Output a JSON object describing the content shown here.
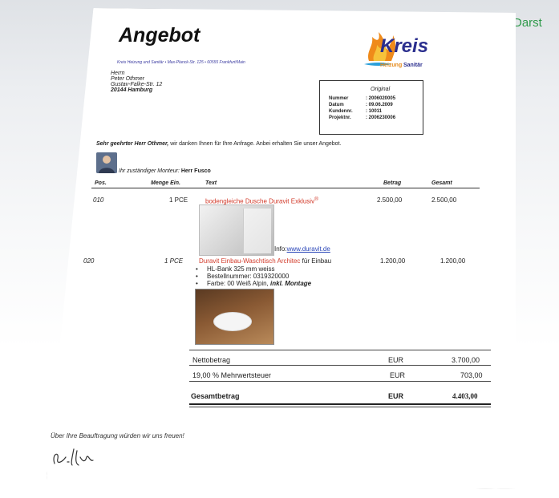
{
  "corner_label": "Darst",
  "document": {
    "title": "Angebot",
    "sender_line": "Kreis Heizung und Sanitär • Max-Planck-Str. 125 • 60555 Frankfurt/Main",
    "recipient": {
      "salutation": "Herrn",
      "name": "Peter Othmer",
      "street": "Gustav-Falke-Str. 12",
      "city": "20144 Hamburg"
    },
    "logo": {
      "name": "Kreis",
      "sub1": "Heizung",
      "sub2": "Sanitär"
    },
    "info_box": {
      "heading": "Original",
      "rows": [
        {
          "label": "Nummer",
          "value": ": 2006020005"
        },
        {
          "label": "Datum",
          "value": ": 09.06.2009"
        },
        {
          "label": "Kundennr.",
          "value": ": 10011"
        },
        {
          "label": "Projektnr.",
          "value": ": 2006230006"
        }
      ]
    },
    "greeting_name": "Sehr geehrter Herr Othmer,",
    "greeting_text": " wir danken Ihnen für Ihre Anfrage. Anbei erhalten Sie unser Angebot.",
    "monteur_text": "Ihr zuständiger Monteur: ",
    "monteur_name": "Herr Fusco",
    "table_headers": {
      "pos": "Pos.",
      "qty": "Menge Ein.",
      "text": "Text",
      "amount": "Betrag",
      "total": "Gesamt"
    },
    "items": [
      {
        "pos": "010",
        "qty": "1 PCE",
        "text": "bodengleiche Dusche Duravit Exklusiv",
        "reg": "®",
        "info_label": "Info:",
        "link": "www.duravit.de",
        "amount": "2.500,00",
        "total": "2.500,00"
      },
      {
        "pos": "020",
        "qty": "1 PCE",
        "text_red": "Duravit Einbau-Waschtisch Architec",
        "text_rest": " für Einbau",
        "bullets": [
          "HL-Bank 325 mm weiss",
          "Bestellnummer:  0319320000",
          "Farbe:  00    Weiß Alpin,"
        ],
        "bullet_bold": " inkl. Montage",
        "amount": "1.200,00",
        "total": "1.200,00"
      }
    ],
    "totals": {
      "net_label": "Nettobetrag",
      "net_cur": "EUR",
      "net_value": "3.700,00",
      "vat_label": "19,00 % Mehrwertsteuer",
      "vat_cur": "EUR",
      "vat_value": "703,00",
      "gross_label": "Gesamtbetrag",
      "gross_cur": "EUR",
      "gross_value": "4.403,00"
    },
    "closing": "Über Ihre Beauftragung würden wir uns freuen!"
  }
}
